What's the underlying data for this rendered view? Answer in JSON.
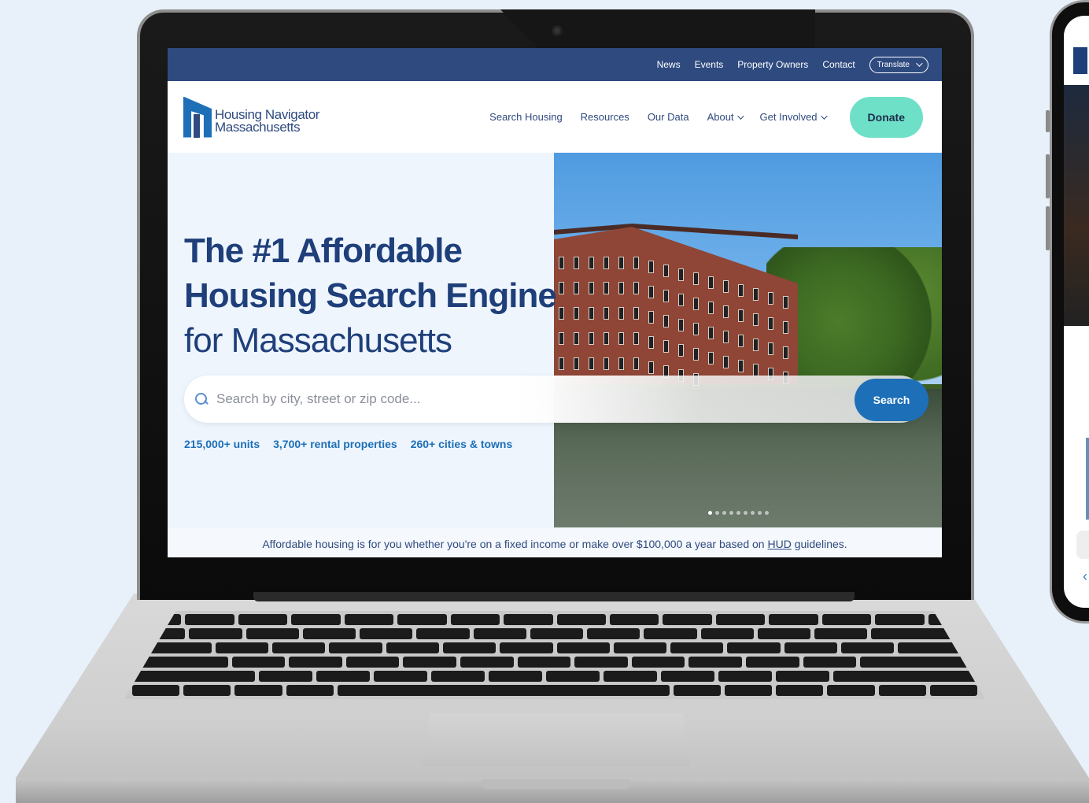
{
  "topbar": {
    "links": [
      "News",
      "Events",
      "Property Owners",
      "Contact"
    ],
    "translate_label": "Translate"
  },
  "brand": {
    "line1": "Housing Navigator",
    "line2": "Massachusetts"
  },
  "nav": {
    "search_housing": "Search Housing",
    "resources": "Resources",
    "our_data": "Our Data",
    "about": "About",
    "get_involved": "Get Involved",
    "donate": "Donate"
  },
  "hero": {
    "title_line1": "The #1 Affordable",
    "title_line2": "Housing Search Engine",
    "title_line3": "for Massachusetts",
    "search_placeholder": "Search by city, street or zip code...",
    "search_button": "Search",
    "stats": [
      "215,000+ units",
      "3,700+ rental properties",
      "260+ cities & towns"
    ],
    "carousel_slides": 9,
    "carousel_active_index": 0
  },
  "note": {
    "text_before": "Affordable housing is for you whether you're on a fixed income or make over $100,000 a year based on ",
    "link": "HUD",
    "text_after": " guidelines."
  },
  "colors": {
    "navy": "#2e4a7f",
    "blue": "#1d6fb8",
    "mint": "#6fe0c8",
    "hero_bg": "#eef5fd"
  }
}
